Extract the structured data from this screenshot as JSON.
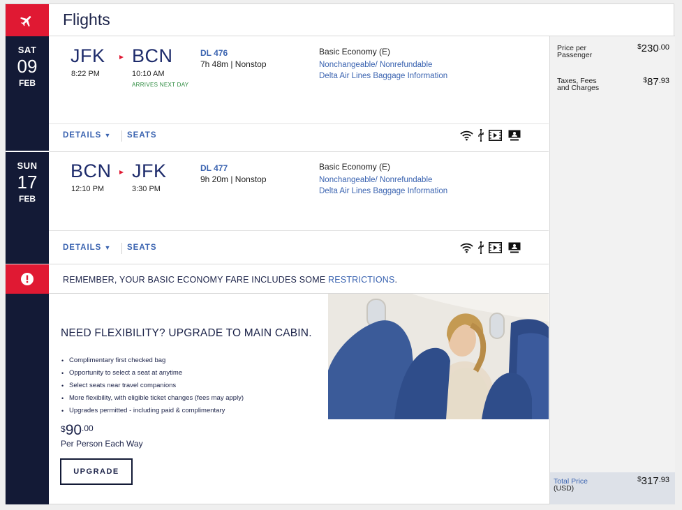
{
  "header": {
    "title": "Flights",
    "icon": "airplane-icon"
  },
  "flights": [
    {
      "day_of_week": "SAT",
      "day": "09",
      "month": "FEB",
      "origin": "JFK",
      "origin_time": "8:22 PM",
      "destination": "BCN",
      "destination_time": "10:10 AM",
      "note": "ARRIVES NEXT DAY",
      "flight_number": "DL 476",
      "duration": "7h 48m | Nonstop",
      "fare_class": "Basic Economy (E)",
      "policy_link": "Nonchangeable/ Nonrefundable",
      "baggage_link": "Delta Air Lines Baggage Information",
      "details_label": "DETAILS",
      "seats_label": "SEATS"
    },
    {
      "day_of_week": "SUN",
      "day": "17",
      "month": "FEB",
      "origin": "BCN",
      "origin_time": "12:10 PM",
      "destination": "JFK",
      "destination_time": "3:30 PM",
      "note": "",
      "flight_number": "DL 477",
      "duration": "9h 20m | Nonstop",
      "fare_class": "Basic Economy (E)",
      "policy_link": "Nonchangeable/ Nonrefundable",
      "baggage_link": "Delta Air Lines Baggage Information",
      "details_label": "DETAILS",
      "seats_label": "SEATS"
    }
  ],
  "amenities": [
    "wifi-icon",
    "usb-icon",
    "video-icon",
    "personal-screen-icon"
  ],
  "restriction": {
    "text": "REMEMBER, YOUR BASIC ECONOMY FARE INCLUDES SOME ",
    "link": "RESTRICTIONS",
    "end": "."
  },
  "upgrade": {
    "title": "NEED FLEXIBILITY? UPGRADE TO MAIN CABIN.",
    "benefits": [
      "Complimentary first checked bag",
      "Opportunity to select a seat at anytime",
      "Select seats near travel companions",
      "More flexibility, with eligible ticket changes (fees may apply)",
      "Upgrades permitted - including paid & complimentary"
    ],
    "price_currency": "$",
    "price_whole": "90",
    "price_cents": ".00",
    "price_note": "Per Person Each Way",
    "button_label": "UPGRADE"
  },
  "pricing": {
    "per_passenger_label": "Price per Passenger",
    "per_passenger_currency": "$",
    "per_passenger_whole": "230",
    "per_passenger_cents": ".00",
    "taxes_label": "Taxes, Fees and Charges",
    "taxes_currency": "$",
    "taxes_whole": "87",
    "taxes_cents": ".93",
    "total_label": "Total Price",
    "total_unit": "(USD)",
    "total_currency": "$",
    "total_whole": "317",
    "total_cents": ".93"
  },
  "colors": {
    "brand_red": "#e01933",
    "navy": "#131a36",
    "link_blue": "#3a63b0",
    "green": "#2b8a3e"
  }
}
